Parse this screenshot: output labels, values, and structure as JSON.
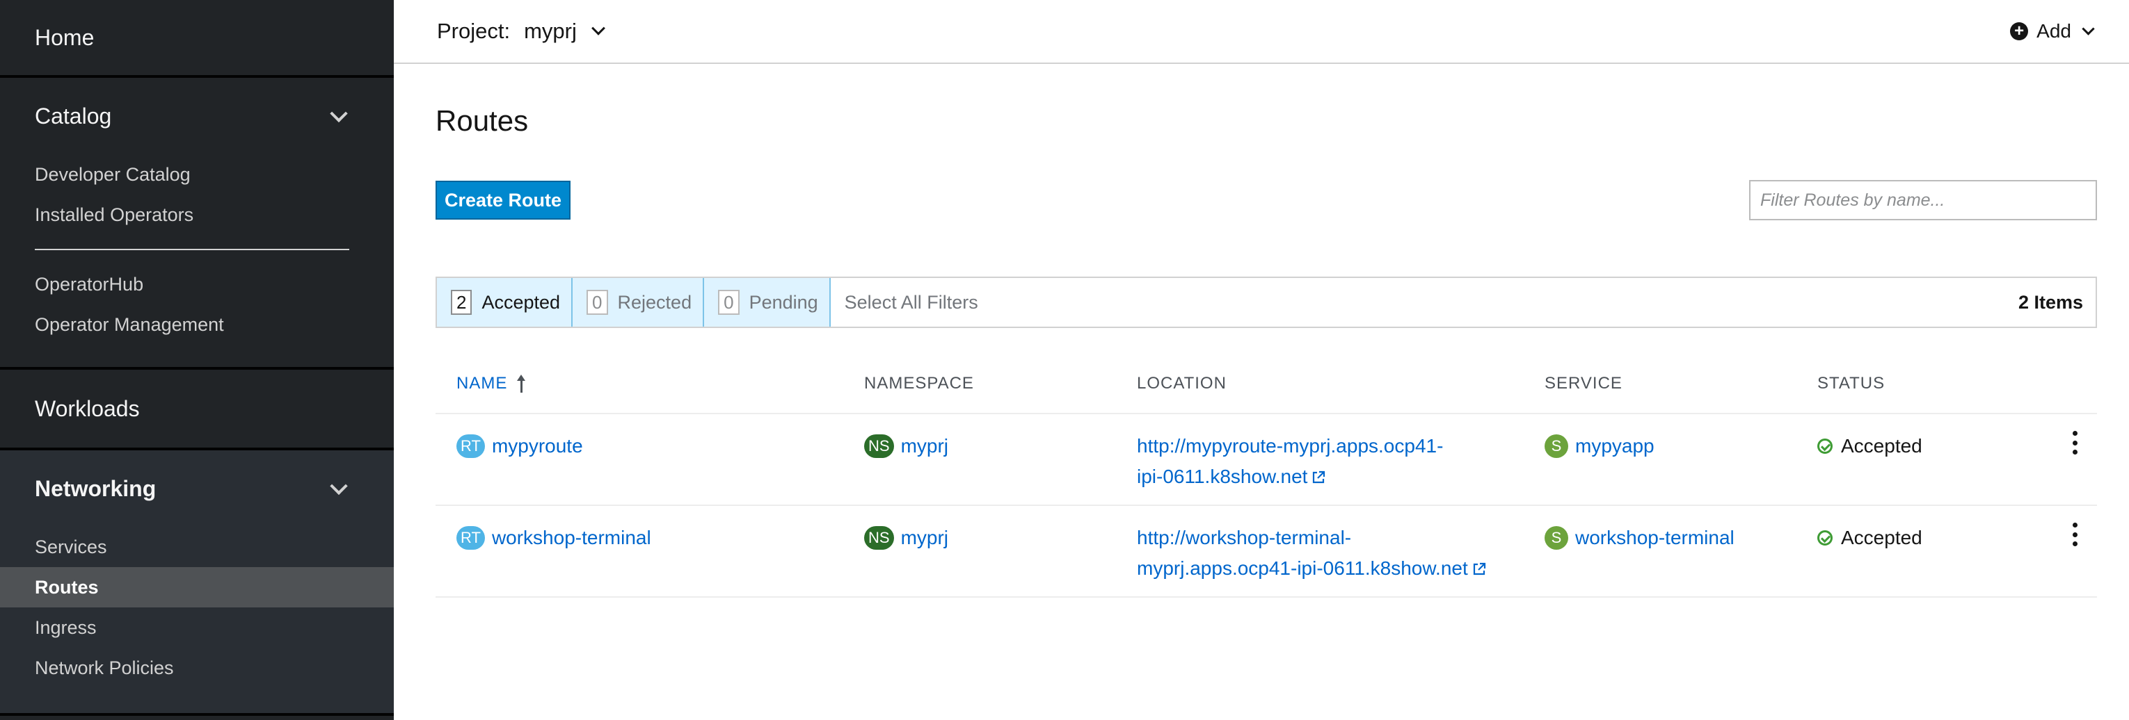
{
  "sidebar": {
    "home": "Home",
    "catalog": {
      "label": "Catalog",
      "items": [
        "Developer Catalog",
        "Installed Operators",
        "OperatorHub",
        "Operator Management"
      ]
    },
    "workloads": "Workloads",
    "networking": {
      "label": "Networking",
      "items": [
        "Services",
        "Routes",
        "Ingress",
        "Network Policies"
      ],
      "active": "Routes"
    }
  },
  "topbar": {
    "project_label": "Project:",
    "project_name": "myprj",
    "add_label": "Add"
  },
  "page": {
    "title": "Routes",
    "create_button": "Create Route",
    "filter_placeholder": "Filter Routes by name..."
  },
  "filters": {
    "accepted": {
      "count": "2",
      "label": "Accepted"
    },
    "rejected": {
      "count": "0",
      "label": "Rejected"
    },
    "pending": {
      "count": "0",
      "label": "Pending"
    },
    "select_all": "Select All Filters",
    "items": "2 Items"
  },
  "table": {
    "columns": {
      "name": "NAME",
      "namespace": "NAMESPACE",
      "location": "LOCATION",
      "service": "SERVICE",
      "status": "STATUS"
    },
    "rows": [
      {
        "name_badge": "RT",
        "name": "mypyroute",
        "ns_badge": "NS",
        "namespace": "myprj",
        "location_line1": "http://mypyroute-myprj.apps.ocp41-",
        "location_line2": "ipi-0611.k8show.net",
        "svc_badge": "S",
        "service": "mypyapp",
        "status": "Accepted"
      },
      {
        "name_badge": "RT",
        "name": "workshop-terminal",
        "ns_badge": "NS",
        "namespace": "myprj",
        "location_line1": "http://workshop-terminal-",
        "location_line2": "myprj.apps.ocp41-ipi-0611.k8show.net",
        "svc_badge": "S",
        "service": "workshop-terminal",
        "status": "Accepted"
      }
    ]
  },
  "colors": {
    "sidebar_bg": "#212427",
    "primary": "#0088ce",
    "link": "#0066cc",
    "success": "#3f9c35"
  }
}
